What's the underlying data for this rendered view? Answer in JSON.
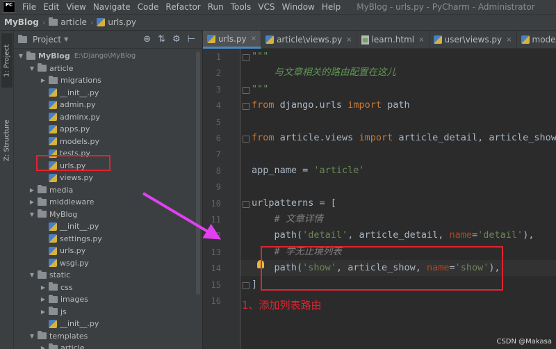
{
  "menubar": {
    "logo": "PC",
    "items": [
      "File",
      "Edit",
      "View",
      "Navigate",
      "Code",
      "Refactor",
      "Run",
      "Tools",
      "VCS",
      "Window",
      "Help"
    ],
    "window_title": "MyBlog - urls.py - PyCharm - Administrator"
  },
  "navbar": {
    "crumbs": [
      "MyBlog",
      "article",
      "urls.py"
    ]
  },
  "toolstrip": {
    "tabs": [
      "1: Project",
      "Z: Structure"
    ]
  },
  "project_panel": {
    "title": "Project",
    "tree": [
      {
        "label": "MyBlog",
        "hint": "E:\\Django\\MyBlog",
        "type": "folder",
        "depth": 0,
        "expanded": true
      },
      {
        "label": "article",
        "type": "folder",
        "depth": 1,
        "expanded": true
      },
      {
        "label": "migrations",
        "type": "folder",
        "depth": 2,
        "expanded": false
      },
      {
        "label": "__init__.py",
        "type": "py",
        "depth": 2
      },
      {
        "label": "admin.py",
        "type": "py",
        "depth": 2
      },
      {
        "label": "adminx.py",
        "type": "py",
        "depth": 2
      },
      {
        "label": "apps.py",
        "type": "py",
        "depth": 2
      },
      {
        "label": "models.py",
        "type": "py",
        "depth": 2
      },
      {
        "label": "tests.py",
        "type": "py",
        "depth": 2
      },
      {
        "label": "urls.py",
        "type": "py",
        "depth": 2
      },
      {
        "label": "views.py",
        "type": "py",
        "depth": 2
      },
      {
        "label": "media",
        "type": "folder",
        "depth": 1,
        "expanded": false
      },
      {
        "label": "middleware",
        "type": "folder",
        "depth": 1,
        "expanded": false
      },
      {
        "label": "MyBlog",
        "type": "folder",
        "depth": 1,
        "expanded": true
      },
      {
        "label": "__init__.py",
        "type": "py",
        "depth": 2
      },
      {
        "label": "settings.py",
        "type": "py",
        "depth": 2
      },
      {
        "label": "urls.py",
        "type": "py",
        "depth": 2
      },
      {
        "label": "wsgi.py",
        "type": "py",
        "depth": 2
      },
      {
        "label": "static",
        "type": "folder",
        "depth": 1,
        "expanded": true
      },
      {
        "label": "css",
        "type": "folder",
        "depth": 2,
        "expanded": false
      },
      {
        "label": "images",
        "type": "folder",
        "depth": 2,
        "expanded": false
      },
      {
        "label": "js",
        "type": "folder",
        "depth": 2,
        "expanded": false
      },
      {
        "label": "__init__.py",
        "type": "py",
        "depth": 2
      },
      {
        "label": "templates",
        "type": "folder",
        "depth": 1,
        "expanded": true
      },
      {
        "label": "article",
        "type": "folder",
        "depth": 2,
        "expanded": false
      }
    ]
  },
  "editor": {
    "tabs": [
      {
        "label": "urls.py",
        "icon": "py",
        "active": true
      },
      {
        "label": "article\\views.py",
        "icon": "py",
        "active": false
      },
      {
        "label": "learn.html",
        "icon": "html",
        "active": false
      },
      {
        "label": "user\\views.py",
        "icon": "py",
        "active": false
      },
      {
        "label": "models.py",
        "icon": "py",
        "active": false
      }
    ],
    "line_numbers": [
      "1",
      "2",
      "3",
      "4",
      "5",
      "6",
      "7",
      "8",
      "9",
      "10",
      "11",
      "12",
      "13",
      "14",
      "15",
      "16"
    ],
    "current_line": 14,
    "lines": [
      [
        {
          "t": "\"\"\"",
          "c": "doc"
        }
      ],
      [
        {
          "t": "    与文章相关的路由配置在这儿",
          "c": "doc"
        }
      ],
      [
        {
          "t": "\"\"\"",
          "c": "doc"
        }
      ],
      [
        {
          "t": "from",
          "c": "kw"
        },
        {
          "t": " django.urls ",
          "c": "plain"
        },
        {
          "t": "import",
          "c": "kw"
        },
        {
          "t": " path",
          "c": "plain"
        }
      ],
      [],
      [
        {
          "t": "from",
          "c": "kw"
        },
        {
          "t": " article.views ",
          "c": "plain"
        },
        {
          "t": "import",
          "c": "kw"
        },
        {
          "t": " article_detail, article_show",
          "c": "plain"
        }
      ],
      [],
      [
        {
          "t": "app_name = ",
          "c": "plain"
        },
        {
          "t": "'article'",
          "c": "str"
        }
      ],
      [],
      [
        {
          "t": "urlpatterns = [",
          "c": "plain"
        }
      ],
      [
        {
          "t": "    # 文章详情",
          "c": "cm"
        }
      ],
      [
        {
          "t": "    path(",
          "c": "plain"
        },
        {
          "t": "'detail'",
          "c": "str"
        },
        {
          "t": ", article_detail, ",
          "c": "plain"
        },
        {
          "t": "name",
          "c": "param"
        },
        {
          "t": "=",
          "c": "plain"
        },
        {
          "t": "'detail'",
          "c": "str"
        },
        {
          "t": "),",
          "c": "plain"
        }
      ],
      [
        {
          "t": "    # 学无止境列表",
          "c": "cm"
        }
      ],
      [
        {
          "t": "    path(",
          "c": "plain"
        },
        {
          "t": "'show'",
          "c": "str"
        },
        {
          "t": ", article_show, ",
          "c": "plain"
        },
        {
          "t": "name",
          "c": "param"
        },
        {
          "t": "=",
          "c": "plain"
        },
        {
          "t": "'show'",
          "c": "str"
        },
        {
          "t": "),",
          "c": "plain"
        }
      ],
      [
        {
          "t": "]",
          "c": "plain"
        }
      ],
      []
    ]
  },
  "annotation": "1、添加列表路由",
  "watermark": "CSDN @Makasa",
  "colors": {
    "highlight_box": "#e0242f",
    "arrow": "#e040f0"
  }
}
